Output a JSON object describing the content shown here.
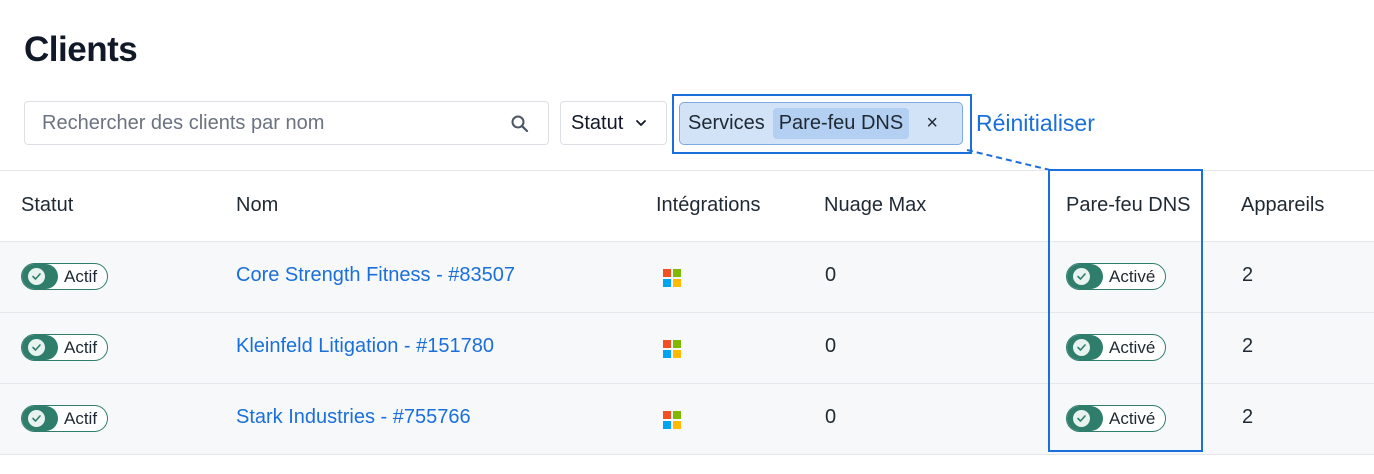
{
  "page": {
    "title": "Clients"
  },
  "toolbar": {
    "search_placeholder": "Rechercher des clients par nom",
    "search_value": "",
    "status_label": "Statut",
    "filter_chip": {
      "key": "Services",
      "value": "Pare-feu DNS",
      "close_symbol": "×"
    },
    "reset_label": "Réinitialiser"
  },
  "table": {
    "columns": [
      "Statut",
      "Nom",
      "Intégrations",
      "Nuage Max",
      "Pare-feu DNS",
      "Appareils"
    ],
    "rows": [
      {
        "status": "Actif",
        "name": "Core Strength Fitness - #83507",
        "integration_icon": "microsoft-icon",
        "nuage_max": "0",
        "dns_firewall": "Activé",
        "devices": "2"
      },
      {
        "status": "Actif",
        "name": "Kleinfeld Litigation - #151780",
        "integration_icon": "microsoft-icon",
        "nuage_max": "0",
        "dns_firewall": "Activé",
        "devices": "2"
      },
      {
        "status": "Actif",
        "name": "Stark Industries - #755766",
        "integration_icon": "microsoft-icon",
        "nuage_max": "0",
        "dns_firewall": "Activé",
        "devices": "2"
      }
    ]
  },
  "colors": {
    "accent": "#1a6fdb",
    "toggle_green": "#2f7d6b",
    "chip_bg": "#d2e3f8",
    "ms_red": "#f25022",
    "ms_green": "#7fba00",
    "ms_blue": "#00a4ef",
    "ms_yellow": "#ffb900"
  }
}
